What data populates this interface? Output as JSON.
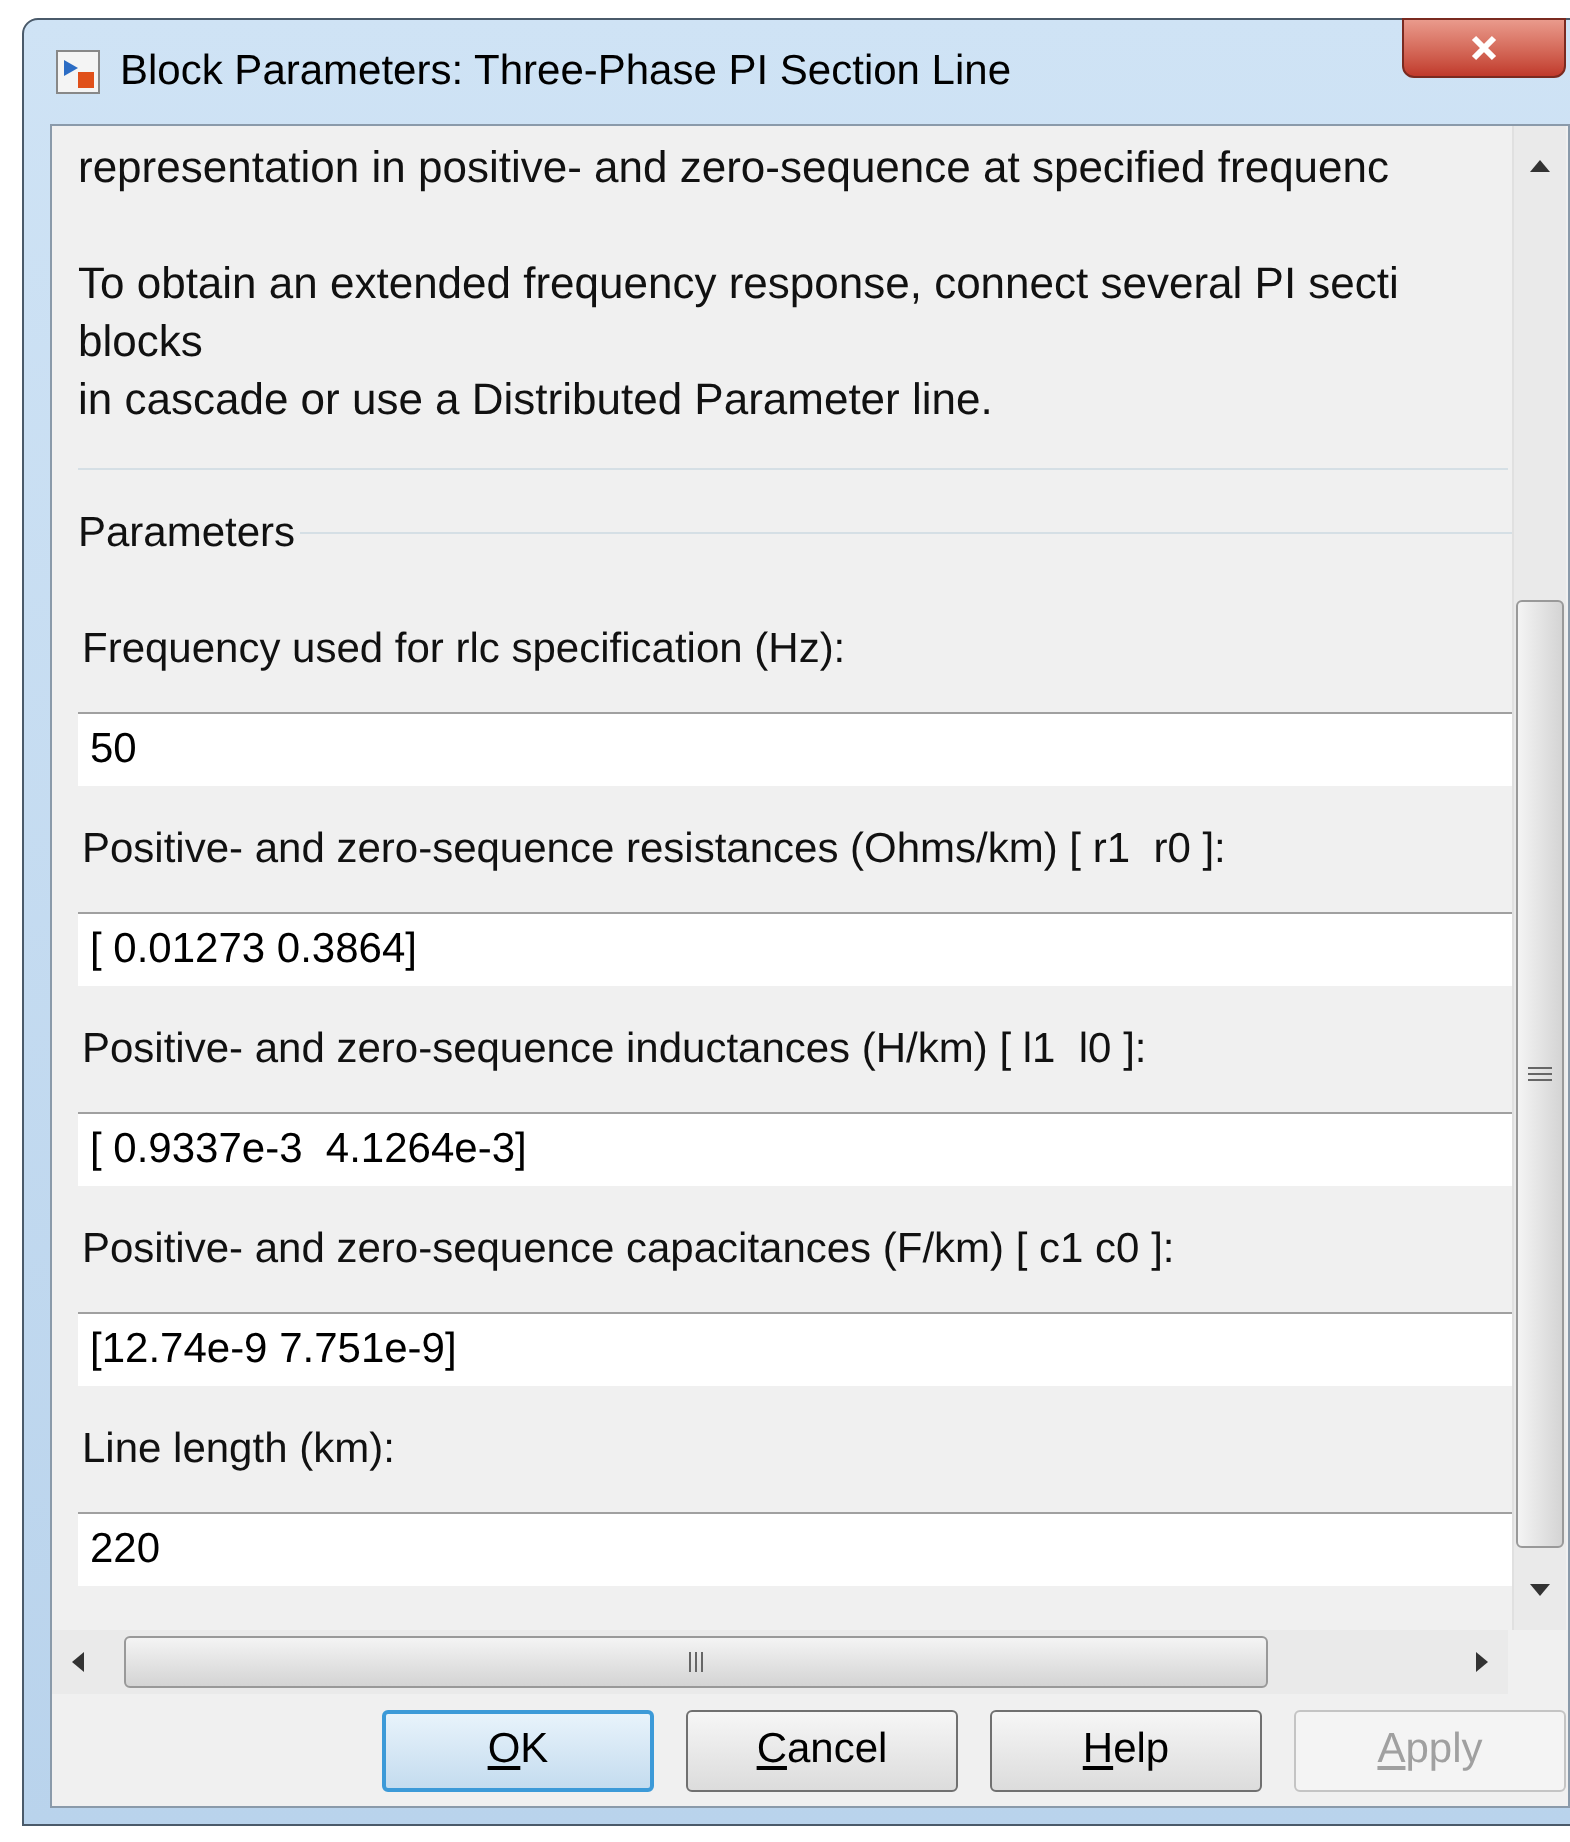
{
  "window": {
    "title": "Block Parameters: Three-Phase PI Section Line"
  },
  "description": [
    {
      "lines": [
        "representation in positive- and zero-sequence at specified frequenc"
      ]
    },
    {
      "lines": [
        "To obtain an extended frequency response, connect several PI secti",
        "blocks",
        "in cascade or use a Distributed Parameter line."
      ]
    }
  ],
  "parameters": {
    "title": "Parameters",
    "fields": [
      {
        "label": "Frequency used for rlc specification (Hz):",
        "value": "50"
      },
      {
        "label": "Positive- and zero-sequence resistances (Ohms/km) [ r1  r0 ]:",
        "value": "[ 0.01273 0.3864]"
      },
      {
        "label": "Positive- and zero-sequence inductances (H/km) [ l1  l0 ]:",
        "value": "[ 0.9337e-3  4.1264e-3]"
      },
      {
        "label": "Positive- and zero-sequence capacitances (F/km) [ c1 c0 ]:",
        "value": "[12.74e-9 7.751e-9]"
      },
      {
        "label": "Line length (km):",
        "value": "220"
      }
    ]
  },
  "buttons": [
    {
      "label": "OK",
      "mnemonic": true,
      "default": true,
      "disabled": false
    },
    {
      "label": "Cancel",
      "mnemonic": true,
      "default": false,
      "disabled": false
    },
    {
      "label": "Help",
      "mnemonic": true,
      "default": false,
      "disabled": false
    },
    {
      "label": "Apply",
      "mnemonic": true,
      "default": false,
      "disabled": true
    }
  ]
}
